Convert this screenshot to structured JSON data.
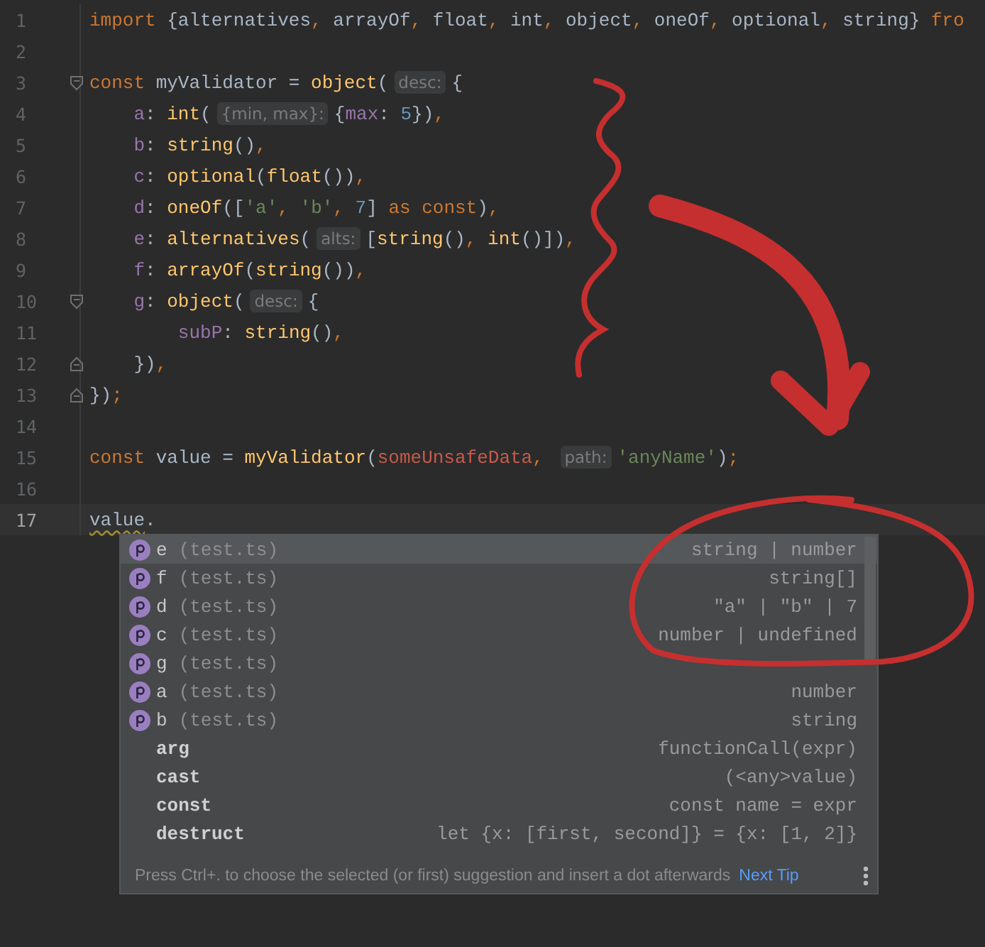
{
  "editor": {
    "lines": [
      {
        "number": "1",
        "current": false,
        "fold_start": false,
        "fold_end": false,
        "tokens": [
          {
            "kind": "keyword",
            "text": "import "
          },
          {
            "kind": "plain",
            "text": "{alternatives"
          },
          {
            "kind": "keyword",
            "text": ", "
          },
          {
            "kind": "plain",
            "text": "arrayOf"
          },
          {
            "kind": "keyword",
            "text": ", "
          },
          {
            "kind": "plain",
            "text": "float"
          },
          {
            "kind": "keyword",
            "text": ", "
          },
          {
            "kind": "plain",
            "text": "int"
          },
          {
            "kind": "keyword",
            "text": ", "
          },
          {
            "kind": "plain",
            "text": "object"
          },
          {
            "kind": "keyword",
            "text": ", "
          },
          {
            "kind": "plain",
            "text": "oneOf"
          },
          {
            "kind": "keyword",
            "text": ", "
          },
          {
            "kind": "plain",
            "text": "optional"
          },
          {
            "kind": "keyword",
            "text": ", "
          },
          {
            "kind": "plain",
            "text": "string} "
          },
          {
            "kind": "keyword",
            "text": "fro"
          }
        ]
      },
      {
        "number": "2",
        "current": false,
        "fold_start": false,
        "fold_end": false
      },
      {
        "number": "3",
        "current": false,
        "fold_start": true,
        "fold_end": false,
        "tokens": [
          {
            "kind": "keyword",
            "text": "const "
          },
          {
            "kind": "plain",
            "text": "myValidator = "
          },
          {
            "kind": "function",
            "text": "object"
          },
          {
            "kind": "plain",
            "text": "("
          },
          {
            "kind": "hint",
            "text": "desc:"
          },
          {
            "kind": "plain",
            "text": "{"
          }
        ]
      },
      {
        "number": "4",
        "current": false,
        "fold_start": false,
        "fold_end": false,
        "tokens": [
          {
            "kind": "member",
            "text": "    a"
          },
          {
            "kind": "plain",
            "text": ": "
          },
          {
            "kind": "function",
            "text": "int"
          },
          {
            "kind": "plain",
            "text": "("
          },
          {
            "kind": "hint",
            "text": "{min, max}:"
          },
          {
            "kind": "plain",
            "text": "{"
          },
          {
            "kind": "member",
            "text": "max"
          },
          {
            "kind": "plain",
            "text": ": "
          },
          {
            "kind": "number",
            "text": "5"
          },
          {
            "kind": "plain",
            "text": "})"
          },
          {
            "kind": "keyword",
            "text": ","
          }
        ]
      },
      {
        "number": "5",
        "current": false,
        "fold_start": false,
        "fold_end": false,
        "tokens": [
          {
            "kind": "member",
            "text": "    b"
          },
          {
            "kind": "plain",
            "text": ": "
          },
          {
            "kind": "function",
            "text": "string"
          },
          {
            "kind": "plain",
            "text": "()"
          },
          {
            "kind": "keyword",
            "text": ","
          }
        ]
      },
      {
        "number": "6",
        "current": false,
        "fold_start": false,
        "fold_end": false,
        "tokens": [
          {
            "kind": "member",
            "text": "    c"
          },
          {
            "kind": "plain",
            "text": ": "
          },
          {
            "kind": "function",
            "text": "optional"
          },
          {
            "kind": "plain",
            "text": "("
          },
          {
            "kind": "function",
            "text": "float"
          },
          {
            "kind": "plain",
            "text": "())"
          },
          {
            "kind": "keyword",
            "text": ","
          }
        ]
      },
      {
        "number": "7",
        "current": false,
        "fold_start": false,
        "fold_end": false,
        "tokens": [
          {
            "kind": "member",
            "text": "    d"
          },
          {
            "kind": "plain",
            "text": ": "
          },
          {
            "kind": "function",
            "text": "oneOf"
          },
          {
            "kind": "plain",
            "text": "(["
          },
          {
            "kind": "string",
            "text": "'a'"
          },
          {
            "kind": "keyword",
            "text": ", "
          },
          {
            "kind": "string",
            "text": "'b'"
          },
          {
            "kind": "keyword",
            "text": ", "
          },
          {
            "kind": "number",
            "text": "7"
          },
          {
            "kind": "plain",
            "text": "] "
          },
          {
            "kind": "keyword",
            "text": "as const"
          },
          {
            "kind": "plain",
            "text": ")"
          },
          {
            "kind": "keyword",
            "text": ","
          }
        ]
      },
      {
        "number": "8",
        "current": false,
        "fold_start": false,
        "fold_end": false,
        "tokens": [
          {
            "kind": "member",
            "text": "    e"
          },
          {
            "kind": "plain",
            "text": ": "
          },
          {
            "kind": "function",
            "text": "alternatives"
          },
          {
            "kind": "plain",
            "text": "("
          },
          {
            "kind": "hint",
            "text": "alts:"
          },
          {
            "kind": "plain",
            "text": "["
          },
          {
            "kind": "function",
            "text": "string"
          },
          {
            "kind": "plain",
            "text": "()"
          },
          {
            "kind": "keyword",
            "text": ", "
          },
          {
            "kind": "function",
            "text": "int"
          },
          {
            "kind": "plain",
            "text": "()])"
          },
          {
            "kind": "keyword",
            "text": ","
          }
        ]
      },
      {
        "number": "9",
        "current": false,
        "fold_start": false,
        "fold_end": false,
        "tokens": [
          {
            "kind": "member",
            "text": "    f"
          },
          {
            "kind": "plain",
            "text": ": "
          },
          {
            "kind": "function",
            "text": "arrayOf"
          },
          {
            "kind": "plain",
            "text": "("
          },
          {
            "kind": "function",
            "text": "string"
          },
          {
            "kind": "plain",
            "text": "())"
          },
          {
            "kind": "keyword",
            "text": ","
          }
        ]
      },
      {
        "number": "10",
        "current": false,
        "fold_start": true,
        "fold_end": false,
        "tokens": [
          {
            "kind": "member",
            "text": "    g"
          },
          {
            "kind": "plain",
            "text": ": "
          },
          {
            "kind": "function",
            "text": "object"
          },
          {
            "kind": "plain",
            "text": "("
          },
          {
            "kind": "hint",
            "text": "desc:"
          },
          {
            "kind": "plain",
            "text": "{"
          }
        ]
      },
      {
        "number": "11",
        "current": false,
        "fold_start": false,
        "fold_end": false,
        "tokens": [
          {
            "kind": "member",
            "text": "        subP"
          },
          {
            "kind": "plain",
            "text": ": "
          },
          {
            "kind": "function",
            "text": "string"
          },
          {
            "kind": "plain",
            "text": "()"
          },
          {
            "kind": "keyword",
            "text": ","
          }
        ]
      },
      {
        "number": "12",
        "current": false,
        "fold_start": false,
        "fold_end": true,
        "tokens": [
          {
            "kind": "plain",
            "text": "    })"
          },
          {
            "kind": "keyword",
            "text": ","
          }
        ]
      },
      {
        "number": "13",
        "current": false,
        "fold_start": false,
        "fold_end": true,
        "tokens": [
          {
            "kind": "plain",
            "text": "})"
          },
          {
            "kind": "keyword",
            "text": ";"
          }
        ]
      },
      {
        "number": "14",
        "current": false,
        "fold_start": false,
        "fold_end": false
      },
      {
        "number": "15",
        "current": false,
        "fold_start": false,
        "fold_end": false,
        "tokens": [
          {
            "kind": "keyword",
            "text": "const "
          },
          {
            "kind": "plain",
            "text": "value = "
          },
          {
            "kind": "function",
            "text": "myValidator"
          },
          {
            "kind": "plain",
            "text": "("
          },
          {
            "kind": "unused",
            "text": "someUnsafeData"
          },
          {
            "kind": "keyword",
            "text": ", "
          },
          {
            "kind": "hint",
            "text": "path:"
          },
          {
            "kind": "string",
            "text": "'anyName'"
          },
          {
            "kind": "plain",
            "text": ")"
          },
          {
            "kind": "keyword",
            "text": ";"
          }
        ]
      },
      {
        "number": "16",
        "current": false,
        "fold_start": false,
        "fold_end": false
      },
      {
        "number": "17",
        "current": true,
        "fold_start": false,
        "fold_end": false,
        "tokens": [
          {
            "kind": "warning",
            "text": "value"
          },
          {
            "kind": "plain",
            "text": "."
          }
        ]
      }
    ]
  },
  "completion": {
    "items": [
      {
        "kind": "property",
        "selected": true,
        "name": "e",
        "source": "(test.ts)",
        "type": "string | number"
      },
      {
        "kind": "property",
        "selected": false,
        "name": "f",
        "source": "(test.ts)",
        "type": "string[]"
      },
      {
        "kind": "property",
        "selected": false,
        "name": "d",
        "source": "(test.ts)",
        "type": "\"a\" | \"b\" | 7"
      },
      {
        "kind": "property",
        "selected": false,
        "name": "c",
        "source": "(test.ts)",
        "type": "number | undefined"
      },
      {
        "kind": "property",
        "selected": false,
        "name": "g",
        "source": "(test.ts)"
      },
      {
        "kind": "property",
        "selected": false,
        "name": "a",
        "source": "(test.ts)",
        "type": "number"
      },
      {
        "kind": "property",
        "selected": false,
        "name": "b",
        "source": "(test.ts)",
        "type": "string"
      },
      {
        "kind": "template",
        "selected": false,
        "name": "arg",
        "type": "functionCall(expr)"
      },
      {
        "kind": "template",
        "selected": false,
        "name": "cast",
        "type": "(<any>value)"
      },
      {
        "kind": "template",
        "selected": false,
        "name": "const",
        "type": "const name = expr"
      },
      {
        "kind": "template",
        "selected": false,
        "name": "destruct",
        "type": "let {x: [first, second]} = {x: [1, 2]}"
      }
    ],
    "tip": "Press Ctrl+. to choose the selected (or first) suggestion and insert a dot afterwards",
    "tip_link": "Next Tip"
  }
}
